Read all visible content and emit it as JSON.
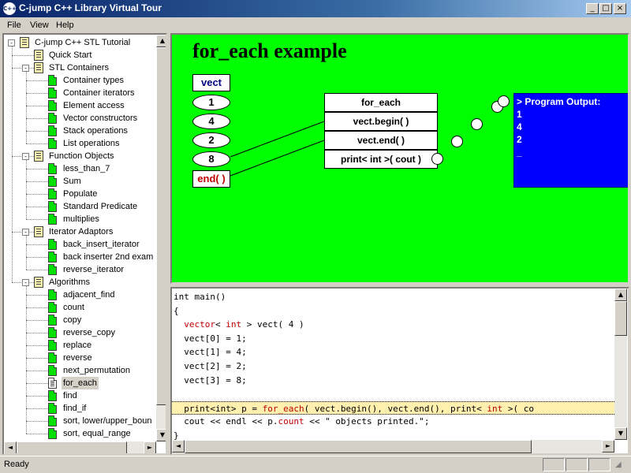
{
  "window": {
    "title": "C-jump C++ Library Virtual Tour",
    "app_icon": "C++"
  },
  "menu": [
    "File",
    "View",
    "Help"
  ],
  "tree": [
    {
      "label": "C-jump C++ STL Tutorial",
      "level": 0,
      "icon": "book",
      "expander": "-"
    },
    {
      "label": "Quick Start",
      "level": 1,
      "icon": "book",
      "expander": ""
    },
    {
      "label": "STL Containers",
      "level": 1,
      "icon": "book",
      "expander": "-"
    },
    {
      "label": "Container types",
      "level": 2,
      "icon": "page",
      "expander": ""
    },
    {
      "label": "Container iterators",
      "level": 2,
      "icon": "page",
      "expander": ""
    },
    {
      "label": "Element access",
      "level": 2,
      "icon": "page",
      "expander": ""
    },
    {
      "label": "Vector constructors",
      "level": 2,
      "icon": "page",
      "expander": ""
    },
    {
      "label": "Stack operations",
      "level": 2,
      "icon": "page",
      "expander": ""
    },
    {
      "label": "List operations",
      "level": 2,
      "icon": "page",
      "expander": ""
    },
    {
      "label": "Function Objects",
      "level": 1,
      "icon": "book",
      "expander": "-"
    },
    {
      "label": "less_than_7",
      "level": 2,
      "icon": "page",
      "expander": ""
    },
    {
      "label": "Sum",
      "level": 2,
      "icon": "page",
      "expander": ""
    },
    {
      "label": "Populate",
      "level": 2,
      "icon": "page",
      "expander": ""
    },
    {
      "label": "Standard Predicate",
      "level": 2,
      "icon": "page",
      "expander": ""
    },
    {
      "label": "multiplies",
      "level": 2,
      "icon": "page",
      "expander": ""
    },
    {
      "label": "Iterator Adaptors",
      "level": 1,
      "icon": "book",
      "expander": "-"
    },
    {
      "label": "back_insert_iterator",
      "level": 2,
      "icon": "page",
      "expander": ""
    },
    {
      "label": "back inserter 2nd exam",
      "level": 2,
      "icon": "page",
      "expander": ""
    },
    {
      "label": "reverse_iterator",
      "level": 2,
      "icon": "page",
      "expander": ""
    },
    {
      "label": "Algorithms",
      "level": 1,
      "icon": "book",
      "expander": "-"
    },
    {
      "label": "adjacent_find",
      "level": 2,
      "icon": "page",
      "expander": ""
    },
    {
      "label": "count",
      "level": 2,
      "icon": "page",
      "expander": ""
    },
    {
      "label": "copy",
      "level": 2,
      "icon": "page",
      "expander": ""
    },
    {
      "label": "reverse_copy",
      "level": 2,
      "icon": "page",
      "expander": ""
    },
    {
      "label": "replace",
      "level": 2,
      "icon": "page",
      "expander": ""
    },
    {
      "label": "reverse",
      "level": 2,
      "icon": "page",
      "expander": ""
    },
    {
      "label": "next_permutation",
      "level": 2,
      "icon": "page",
      "expander": ""
    },
    {
      "label": "for_each",
      "level": 2,
      "icon": "page-open",
      "expander": "",
      "selected": true
    },
    {
      "label": "find",
      "level": 2,
      "icon": "page",
      "expander": ""
    },
    {
      "label": "find_if",
      "level": 2,
      "icon": "page",
      "expander": ""
    },
    {
      "label": "sort, lower/upper_boun",
      "level": 2,
      "icon": "page",
      "expander": ""
    },
    {
      "label": "sort, equal_range",
      "level": 2,
      "icon": "page",
      "expander": ""
    }
  ],
  "diagram": {
    "title": "for_each example",
    "vect_label": "vect",
    "vect_values": [
      "1",
      "4",
      "2",
      "8"
    ],
    "vect_end": "end( )",
    "call_boxes": [
      "for_each",
      "vect.begin( )",
      "vect.end( )",
      "print< int >( cout )"
    ],
    "output_title": "> Program Output:",
    "output_lines": [
      "1",
      "4",
      "2",
      "_"
    ]
  },
  "code": {
    "lines": [
      [
        {
          "t": "int main()",
          "c": ""
        }
      ],
      [
        {
          "t": "{",
          "c": ""
        }
      ],
      [
        {
          "t": "  ",
          "c": ""
        },
        {
          "t": "vector",
          "c": "kw"
        },
        {
          "t": "< ",
          "c": ""
        },
        {
          "t": "int",
          "c": "ty"
        },
        {
          "t": " > vect( 4 )",
          "c": ""
        }
      ],
      [
        {
          "t": "  vect[0] = 1;",
          "c": ""
        }
      ],
      [
        {
          "t": "  vect[1] = 4;",
          "c": ""
        }
      ],
      [
        {
          "t": "  vect[2] = 2;",
          "c": ""
        }
      ],
      [
        {
          "t": "  vect[3] = 8;",
          "c": ""
        }
      ],
      [
        {
          "t": "",
          "c": ""
        }
      ],
      [
        {
          "t": "  print<int> p = ",
          "c": ""
        },
        {
          "t": "for_each",
          "c": "kw"
        },
        {
          "t": "( vect.begin(), vect.end(), print< ",
          "c": ""
        },
        {
          "t": "int",
          "c": "ty"
        },
        {
          "t": " >( co",
          "c": ""
        }
      ],
      [
        {
          "t": "  cout << endl << p.",
          "c": ""
        },
        {
          "t": "count",
          "c": "kw"
        },
        {
          "t": " << \" objects printed.\";",
          "c": ""
        }
      ],
      [
        {
          "t": "}",
          "c": ""
        }
      ]
    ],
    "highlight_line": 8
  },
  "status": {
    "text": "Ready"
  }
}
